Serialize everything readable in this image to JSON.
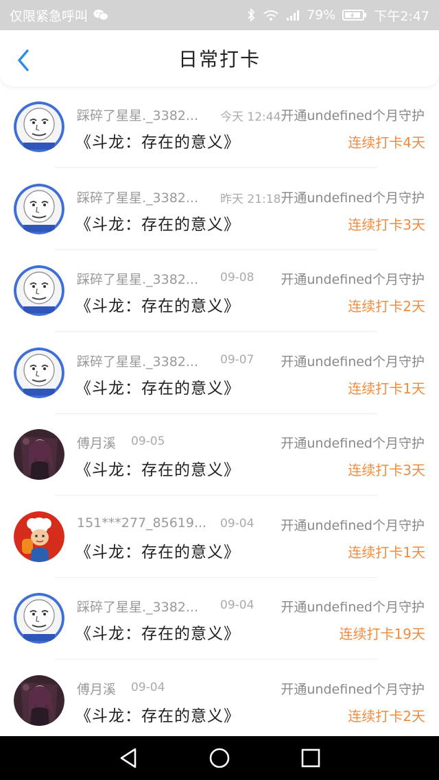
{
  "status_bar": {
    "carrier": "仅限紧急呼叫",
    "battery": "79%",
    "time": "下午2:47",
    "icons": [
      "wechat-icon",
      "bluetooth-icon",
      "wifi-icon",
      "signal-icon",
      "battery-icon"
    ]
  },
  "header": {
    "title": "日常打卡",
    "back_icon": "chevron-left-icon"
  },
  "rows": [
    {
      "avatar": "meme-face",
      "name": "踩碎了星星._3382...",
      "date": "今天 12:44",
      "guard": "开通undefined个月守护",
      "book": "《斗龙：存在的意义》",
      "streak": "连续打卡4天"
    },
    {
      "avatar": "meme-face",
      "name": "踩碎了星星._3382...",
      "date": "昨天 21:18",
      "guard": "开通undefined个月守护",
      "book": "《斗龙：存在的意义》",
      "streak": "连续打卡3天"
    },
    {
      "avatar": "meme-face",
      "name": "踩碎了星星._3382...",
      "date": "09-08",
      "guard": "开通undefined个月守护",
      "book": "《斗龙：存在的意义》",
      "streak": "连续打卡2天"
    },
    {
      "avatar": "meme-face",
      "name": "踩碎了星星._3382...",
      "date": "09-07",
      "guard": "开通undefined个月守护",
      "book": "《斗龙：存在的意义》",
      "streak": "连续打卡1天"
    },
    {
      "avatar": "anime-girl",
      "name": "傅月溪",
      "date": "09-05",
      "guard": "开通undefined个月守护",
      "book": "《斗龙：存在的意义》",
      "streak": "连续打卡3天"
    },
    {
      "avatar": "cartoon-chef",
      "name": "151***277_85619...",
      "date": "09-04",
      "guard": "开通undefined个月守护",
      "book": "《斗龙：存在的意义》",
      "streak": "连续打卡1天"
    },
    {
      "avatar": "meme-face",
      "name": "踩碎了星星._3382...",
      "date": "09-04",
      "guard": "开通undefined个月守护",
      "book": "《斗龙：存在的意义》",
      "streak": "连续打卡19天"
    },
    {
      "avatar": "anime-girl",
      "name": "傅月溪",
      "date": "09-04",
      "guard": "开通undefined个月守护",
      "book": "《斗龙：存在的意义》",
      "streak": "连续打卡2天"
    }
  ],
  "nav_bar": {
    "icons": [
      "back-triangle-icon",
      "home-circle-icon",
      "recents-square-icon"
    ]
  },
  "colors": {
    "accent_blue": "#2a8be8",
    "streak_orange": "#f28b3c",
    "status_bar_bg": "#d3d3d3"
  }
}
